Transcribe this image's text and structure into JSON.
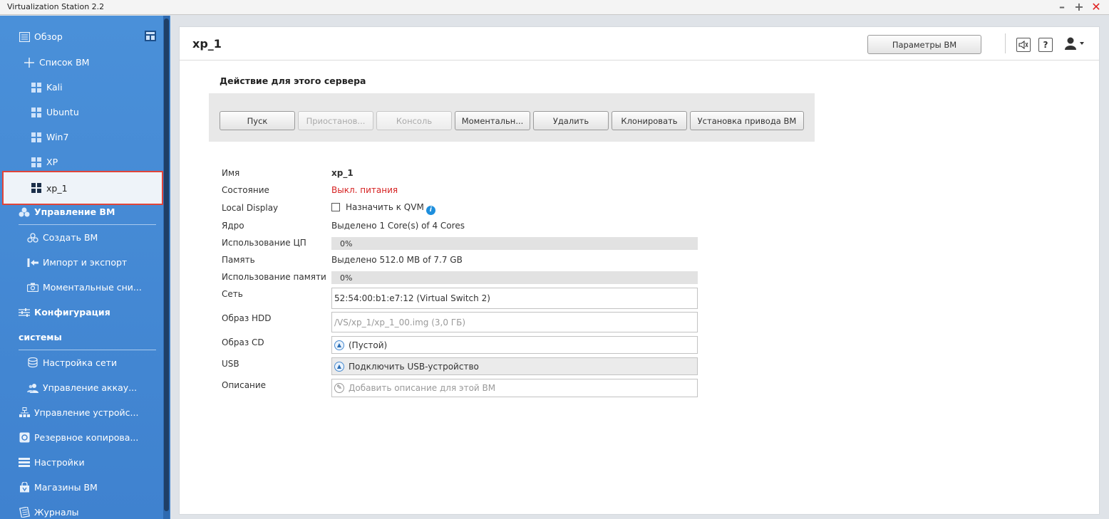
{
  "window": {
    "title": "Virtualization Station 2.2",
    "controls": [
      "–",
      "+",
      "✕"
    ]
  },
  "sidebar": {
    "items": [
      {
        "label": "Обзор",
        "icon": "overview-icon"
      },
      {
        "label": "Список ВМ",
        "icon": "plus-icon"
      },
      {
        "label": "Kali",
        "icon": "windows-icon"
      },
      {
        "label": "Ubuntu",
        "icon": "windows-icon"
      },
      {
        "label": "Win7",
        "icon": "windows-icon"
      },
      {
        "label": "XP",
        "icon": "windows-icon"
      },
      {
        "label": "xp_1",
        "icon": "windows-icon",
        "selected": true
      },
      {
        "label": "Управление ВМ",
        "icon": "vm-management-icon"
      },
      {
        "label": "Создать ВМ",
        "icon": "create-vm-icon"
      },
      {
        "label": "Импорт и экспорт",
        "icon": "import-export-icon"
      },
      {
        "label": "Моментальные сни...",
        "icon": "camera-icon"
      },
      {
        "label": "Конфигурация",
        "icon": "sliders-icon"
      },
      {
        "label": "системы",
        "icon": ""
      },
      {
        "label": "Настройка сети",
        "icon": "network-icon"
      },
      {
        "label": "Управление аккау...",
        "icon": "users-icon"
      },
      {
        "label": "Управление устройс...",
        "icon": "devices-icon"
      },
      {
        "label": "Резервное копирова...",
        "icon": "backup-icon"
      },
      {
        "label": "Настройки",
        "icon": "settings-list-icon"
      },
      {
        "label": "Магазины ВМ",
        "icon": "store-icon"
      },
      {
        "label": "Журналы",
        "icon": "logs-icon"
      }
    ],
    "overview_side_icon": "layout-icon"
  },
  "header": {
    "title": "xp_1",
    "vm_params_label": "Параметры ВМ",
    "speaker_icon": "speaker-icon",
    "help_label": "?",
    "user_icon": "user-icon"
  },
  "actions": {
    "title": "Действие для этого сервера",
    "buttons": [
      {
        "label": "Пуск",
        "disabled": false
      },
      {
        "label": "Приостанов...",
        "disabled": true
      },
      {
        "label": "Консоль",
        "disabled": true
      },
      {
        "label": "Моментальн...",
        "disabled": false
      },
      {
        "label": "Удалить",
        "disabled": false
      },
      {
        "label": "Клонировать",
        "disabled": false
      },
      {
        "label": "Установка привода ВМ",
        "disabled": false
      }
    ]
  },
  "details": {
    "name_label": "Имя",
    "name_value": "xp_1",
    "state_label": "Состояние",
    "state_value": "Выкл. питания",
    "state_color": "#d62222",
    "local_display_label": "Local Display",
    "local_display_value": "Назначить к QVM",
    "local_display_checked": false,
    "core_label": "Ядро",
    "core_value": "Выделено 1 Core(s) of 4 Cores",
    "cpu_usage_label": "Использование ЦП",
    "cpu_usage_value": "0%",
    "cpu_usage_fraction": 0,
    "memory_label": "Память",
    "memory_value": "Выделено 512.0 MB of 7.7 GB",
    "memory_usage_label": "Использование памяти",
    "memory_usage_value": "0%",
    "memory_usage_fraction": 0,
    "network_label": "Сеть",
    "network_value": "52:54:00:b1:e7:12 (Virtual Switch 2)",
    "hdd_label": "Образ HDD",
    "hdd_value": "/VS/xp_1/xp_1_00.img (3,0 ГБ)",
    "cd_label": "Образ CD",
    "cd_value": "(Пустой)",
    "usb_label": "USB",
    "usb_value": "Подключить USB-устройство",
    "description_label": "Описание",
    "description_placeholder": "Добавить описание для этой ВМ"
  }
}
